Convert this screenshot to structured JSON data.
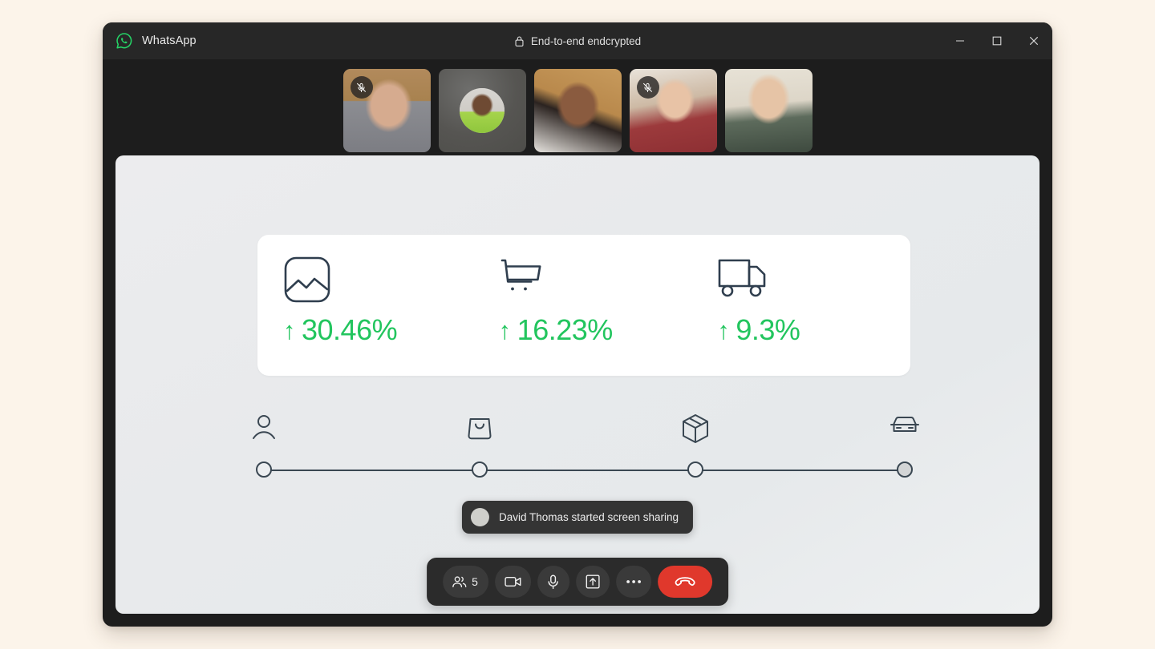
{
  "window": {
    "app_name": "WhatsApp",
    "encryption_label": "End-to-end endcrypted",
    "icons": {
      "brand": "whatsapp-logo-icon",
      "lock": "lock-icon"
    },
    "controls": {
      "minimize": "minimize-icon",
      "maximize": "maximize-icon",
      "close": "close-icon"
    }
  },
  "participants_strip": [
    {
      "id": "tile-1",
      "camera_on": true,
      "muted": true,
      "style": "p1"
    },
    {
      "id": "tile-2",
      "camera_on": false,
      "muted": false,
      "style": "av",
      "is_presenter": true
    },
    {
      "id": "tile-3",
      "camera_on": true,
      "muted": false,
      "style": "p3"
    },
    {
      "id": "tile-4",
      "camera_on": true,
      "muted": true,
      "style": "p4"
    },
    {
      "id": "tile-5",
      "camera_on": true,
      "muted": false,
      "style": "p5"
    }
  ],
  "shared_screen": {
    "stats": [
      {
        "icon": "image-chart-icon",
        "arrow": "↑",
        "value": "30.46%"
      },
      {
        "icon": "shopping-cart-icon",
        "arrow": "↑",
        "value": "16.23%"
      },
      {
        "icon": "delivery-truck-icon",
        "arrow": "↑",
        "value": "9.3%"
      }
    ],
    "funnel": {
      "steps": [
        {
          "icon": "user-icon",
          "filled": false,
          "pct": 1
        },
        {
          "icon": "shopping-bag-icon",
          "filled": false,
          "pct": 34
        },
        {
          "icon": "package-box-icon",
          "filled": false,
          "pct": 67
        },
        {
          "icon": "car-icon",
          "filled": true,
          "pct": 99
        }
      ]
    },
    "accent_colors": {
      "positive": "#22c55e",
      "icon_stroke": "#2f3e4e",
      "card_background": "#ffffff",
      "stage_background": "#e9ebed"
    }
  },
  "toast": {
    "message": "David Thomas started screen sharing",
    "avatar": "participant-avatar"
  },
  "call_controls": {
    "participants": {
      "label": "5",
      "icon": "people-icon"
    },
    "camera": {
      "icon": "video-camera-icon"
    },
    "microphone": {
      "icon": "microphone-icon"
    },
    "share_screen": {
      "icon": "share-screen-icon"
    },
    "more": {
      "icon": "more-horizontal-icon"
    },
    "end_call": {
      "icon": "end-call-icon",
      "color": "#e0382c"
    }
  }
}
